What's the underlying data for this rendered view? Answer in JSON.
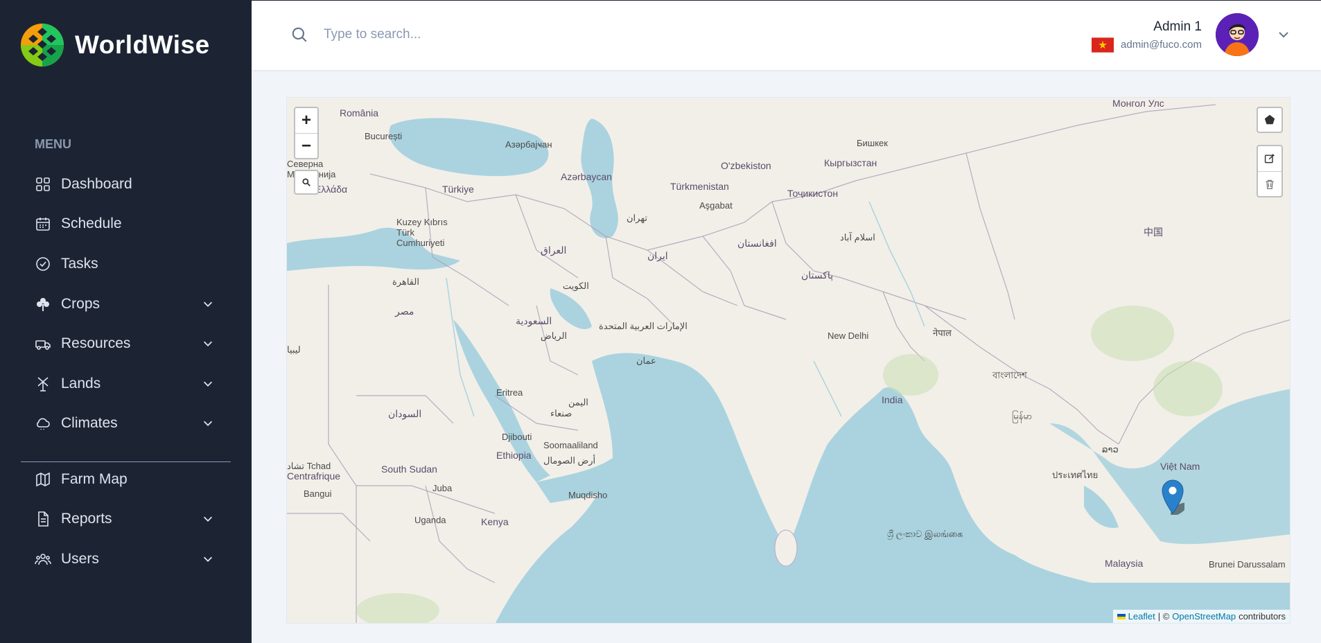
{
  "brand": {
    "name": "WorldWise"
  },
  "sidebar": {
    "menu_heading": "MENU",
    "items": [
      {
        "label": "Dashboard",
        "icon": "grid-icon",
        "has_submenu": false
      },
      {
        "label": "Schedule",
        "icon": "calendar-icon",
        "has_submenu": false
      },
      {
        "label": "Tasks",
        "icon": "check-circle-icon",
        "has_submenu": false
      },
      {
        "label": "Crops",
        "icon": "clover-icon",
        "has_submenu": true
      },
      {
        "label": "Resources",
        "icon": "truck-icon",
        "has_submenu": true
      },
      {
        "label": "Lands",
        "icon": "windmill-icon",
        "has_submenu": true
      },
      {
        "label": "Climates",
        "icon": "cloud-icon",
        "has_submenu": true
      }
    ],
    "items_secondary": [
      {
        "label": "Farm Map",
        "icon": "map-icon",
        "has_submenu": false
      },
      {
        "label": "Reports",
        "icon": "document-icon",
        "has_submenu": true
      },
      {
        "label": "Users",
        "icon": "users-icon",
        "has_submenu": true
      }
    ]
  },
  "header": {
    "search_placeholder": "Type to search...",
    "user_name": "Admin 1",
    "user_email": "admin@fuco.com"
  },
  "map": {
    "zoom_in": "+",
    "zoom_out": "−",
    "attribution": {
      "leaflet": "Leaflet",
      "separator": "| ©",
      "osm": "OpenStreetMap",
      "suffix": "contributors"
    },
    "labels": [
      {
        "text": "România",
        "cls": "country"
      },
      {
        "text": "București",
        "cls": ""
      },
      {
        "text": "Türkiye",
        "cls": "country"
      },
      {
        "text": "Азәрбајҹан",
        "cls": ""
      },
      {
        "text": "Azərbaycan",
        "cls": "country"
      },
      {
        "text": "Türkmenistan",
        "cls": "country"
      },
      {
        "text": "Aşgabat",
        "cls": ""
      },
      {
        "text": "O'zbekiston",
        "cls": "country"
      },
      {
        "text": "Бишкек",
        "cls": ""
      },
      {
        "text": "Кыргызстан",
        "cls": "country"
      },
      {
        "text": "Тоҷикистон",
        "cls": "country"
      },
      {
        "text": "Монгол Улс",
        "cls": "country"
      },
      {
        "text": "中国",
        "cls": "country"
      },
      {
        "text": "ایران",
        "cls": "country"
      },
      {
        "text": "تهران",
        "cls": ""
      },
      {
        "text": "افغانستان",
        "cls": "country"
      },
      {
        "text": "پاکستان",
        "cls": "country"
      },
      {
        "text": "اسلام آباد",
        "cls": ""
      },
      {
        "text": "العراق",
        "cls": "country"
      },
      {
        "text": "الكويت",
        "cls": ""
      },
      {
        "text": "السعودية",
        "cls": "country"
      },
      {
        "text": "الرياض",
        "cls": ""
      },
      {
        "text": "الإمارات العربية المتحدة",
        "cls": ""
      },
      {
        "text": "عمان",
        "cls": ""
      },
      {
        "text": "اليمن",
        "cls": ""
      },
      {
        "text": "صنعاء",
        "cls": ""
      },
      {
        "text": "مصر",
        "cls": "country"
      },
      {
        "text": "القاهرة",
        "cls": ""
      },
      {
        "text": "Kuzey Kıbrıs Türk Cumhuriyeti",
        "cls": ""
      },
      {
        "text": "Ελλάδα",
        "cls": "country"
      },
      {
        "text": "Eritrea",
        "cls": ""
      },
      {
        "text": "السودان",
        "cls": "country"
      },
      {
        "text": "Djibouti",
        "cls": ""
      },
      {
        "text": "Ethiopia",
        "cls": "country"
      },
      {
        "text": "Soomaaliland",
        "cls": ""
      },
      {
        "text": "أرض الصومال",
        "cls": ""
      },
      {
        "text": "Muqdisho",
        "cls": ""
      },
      {
        "text": "South Sudan",
        "cls": "country"
      },
      {
        "text": "Juba",
        "cls": ""
      },
      {
        "text": "Uganda",
        "cls": ""
      },
      {
        "text": "Kenya",
        "cls": "country"
      },
      {
        "text": "Centrafrique",
        "cls": "country"
      },
      {
        "text": "Bangui",
        "cls": ""
      },
      {
        "text": "New Delhi",
        "cls": ""
      },
      {
        "text": "India",
        "cls": "country"
      },
      {
        "text": "नेपाल",
        "cls": ""
      },
      {
        "text": "বাংলাদেশ",
        "cls": ""
      },
      {
        "text": "မြန်မာ",
        "cls": ""
      },
      {
        "text": "ประเทศไทย",
        "cls": ""
      },
      {
        "text": "ລາວ",
        "cls": ""
      },
      {
        "text": "Việt Nam",
        "cls": "country"
      },
      {
        "text": "ශ්‍රී ලංකාව இலங்கை",
        "cls": ""
      },
      {
        "text": "Malaysia",
        "cls": "country"
      },
      {
        "text": "Brunei Darussalam",
        "cls": ""
      },
      {
        "text": "تشاد Tchad",
        "cls": ""
      },
      {
        "text": "Северна Македонија",
        "cls": ""
      },
      {
        "text": "ليبيا",
        "cls": ""
      }
    ]
  },
  "colors": {
    "sidebar_bg": "#1c2434",
    "water": "#aad3df",
    "land": "#f2efe9",
    "marker": "#2a81cb"
  }
}
